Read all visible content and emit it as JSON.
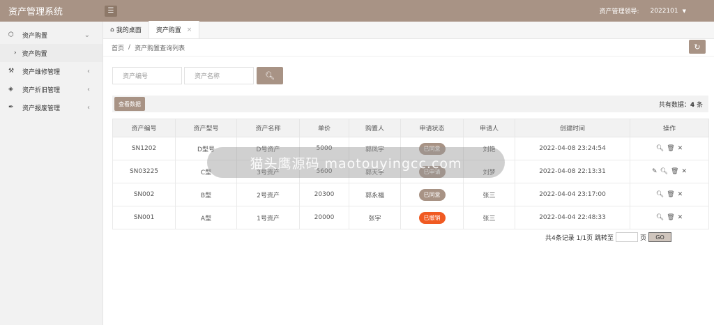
{
  "header": {
    "title": "资产管理系统",
    "menu_icon": "hamburger-icon",
    "role": "资产管理领导:",
    "user": "2022101",
    "caret": "▼"
  },
  "sidebar": {
    "items": [
      {
        "label": "资产购置",
        "icon": "cube-icon",
        "arrow": "⌄"
      },
      {
        "label": "资产维修管理",
        "icon": "tools-icon",
        "arrow": "‹"
      },
      {
        "label": "资产折旧管理",
        "icon": "layers-icon",
        "arrow": "‹"
      },
      {
        "label": "资产报废管理",
        "icon": "pen-icon",
        "arrow": "‹"
      }
    ],
    "sub_item": {
      "label": "资产购置",
      "arrow": "›"
    }
  },
  "tabs": [
    {
      "label": "我的桌面",
      "icon": "home-icon"
    },
    {
      "label": "资产购置",
      "close": "×"
    }
  ],
  "breadcrumb": {
    "home": "首页",
    "sep": "/",
    "current": "资产购置查询列表"
  },
  "search": {
    "code_placeholder": "资产编号",
    "name_placeholder": "资产名称",
    "button_icon": "search-icon"
  },
  "toolbar": {
    "view_btn": "查看数据",
    "total_label": "共有数据：",
    "total_count": "4",
    "total_unit": "条"
  },
  "table": {
    "headers": [
      "资产编号",
      "资产型号",
      "资产名称",
      "单价",
      "购置人",
      "申请状态",
      "申请人",
      "创建时间",
      "操作"
    ],
    "rows": [
      {
        "code": "SN1202",
        "model": "D型号",
        "name": "D号资产",
        "price": "5000",
        "buyer": "郭凤宇",
        "status": "已同意",
        "status_color": "#a89385",
        "applicant": "刘艳",
        "time": "2022-04-08 23:24:54",
        "ops": "🔍 🗑 ✕"
      },
      {
        "code": "SN03225",
        "model": "C型",
        "name": "3号资产",
        "price": "5600",
        "buyer": "郭天宇",
        "status": "已申请",
        "status_color": "#a89385",
        "applicant": "刘梦",
        "time": "2022-04-08 22:13:31",
        "ops": "✎ 🔍 🗑 ✕"
      },
      {
        "code": "SN002",
        "model": "B型",
        "name": "2号资产",
        "price": "20300",
        "buyer": "郭永福",
        "status": "已同意",
        "status_color": "#a89385",
        "applicant": "张三",
        "time": "2022-04-04 23:17:00",
        "ops": "🔍 🗑 ✕"
      },
      {
        "code": "SN001",
        "model": "A型",
        "name": "1号资产",
        "price": "20000",
        "buyer": "张宇",
        "status": "已撤销",
        "status_color": "#f05a22",
        "applicant": "张三",
        "time": "2022-04-04 22:48:33",
        "ops": "🔍 🗑 ✕"
      }
    ]
  },
  "pager": {
    "summary": "共4条记录  1/1页  跳转至",
    "page_suffix": "页",
    "go": "GO"
  },
  "overlay": {
    "text": "猫头鹰源码  maotouyingcc.com"
  },
  "colors": {
    "brand": "#a89385",
    "revoked": "#f05a22"
  }
}
